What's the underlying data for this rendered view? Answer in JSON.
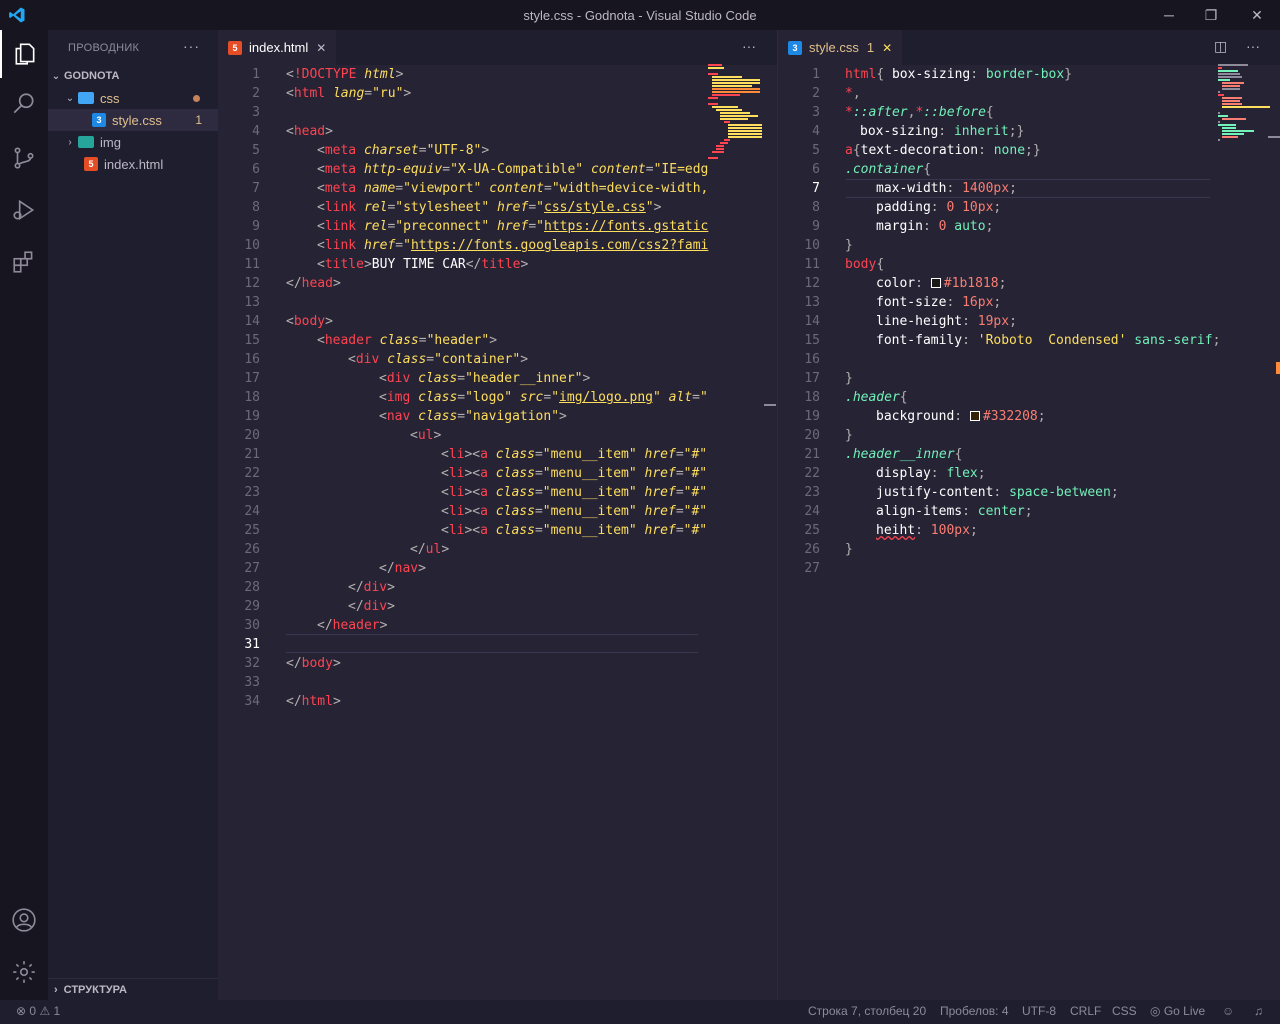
{
  "window": {
    "title": "style.css - Godnota - Visual Studio Code"
  },
  "sidebar": {
    "header": "ПРОВОДНИК",
    "root": "GODNOTA",
    "items": [
      {
        "label": "css",
        "type": "folder"
      },
      {
        "label": "style.css",
        "type": "file",
        "badge": "1"
      },
      {
        "label": "img",
        "type": "folder"
      },
      {
        "label": "index.html",
        "type": "file"
      }
    ],
    "outline": "СТРУКТУРА"
  },
  "left_editor": {
    "tab": "index.html",
    "cursor_line": "31"
  },
  "right_editor": {
    "tab": "style.css",
    "tab_badge": "1",
    "cursor_line": "7"
  },
  "statusbar": {
    "errors": "0",
    "warnings": "1",
    "position": "Строка 7, столбец 20",
    "spaces": "Пробелов: 4",
    "encoding": "UTF-8",
    "eol": "CRLF",
    "language": "CSS",
    "golive": "Go Live"
  },
  "colors": {
    "background": "#262335",
    "tag": "#fe4450",
    "attribute": "#fede5d",
    "string": "#ff8b39",
    "selector_class": "#72f1b8",
    "number": "#f97e72"
  }
}
